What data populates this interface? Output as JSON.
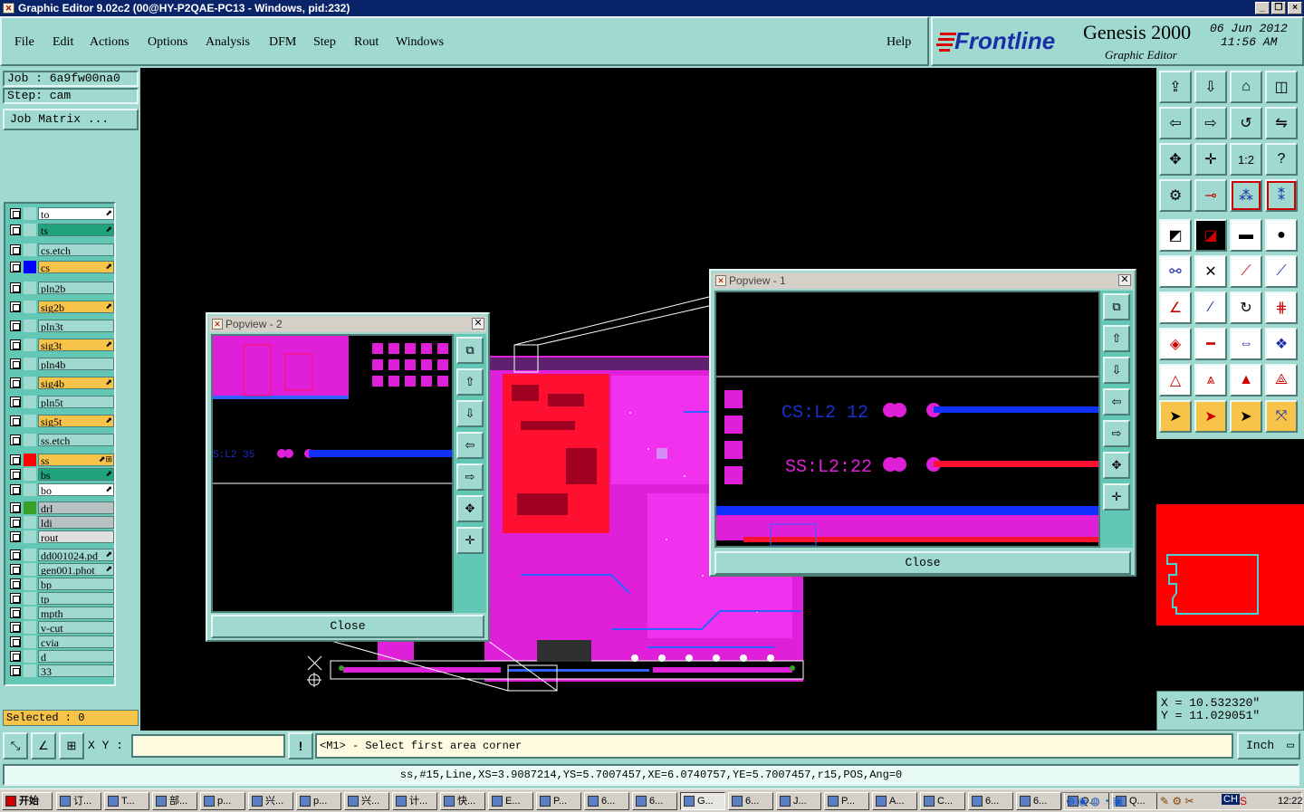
{
  "window": {
    "title": "Graphic Editor 9.02c2 (00@HY-P2QAE-PC13 - Windows, pid:232)",
    "controls": [
      "_",
      "❐",
      "×"
    ]
  },
  "menu": [
    "File",
    "Edit",
    "Actions",
    "Options",
    "Analysis",
    "DFM",
    "Step",
    "Rout",
    "Windows"
  ],
  "help_label": "Help",
  "brand": {
    "logo": "Frontline",
    "product": "Genesis 2000",
    "subtitle": "Graphic Editor",
    "date": "06 Jun 2012",
    "time": "11:56 AM"
  },
  "job": {
    "job_label": "Job : 6a9fw00na0",
    "step_label": "Step: cam",
    "matrix_button": "Job Matrix ..."
  },
  "layers": [
    {
      "name": "to",
      "color": "#ffffff",
      "swatch": "#9fd9cf",
      "edit": "⬈"
    },
    {
      "name": "ts",
      "color": "#1fa37c",
      "swatch": "#9fd9cf",
      "edit": "⬈"
    },
    {
      "name": "cs.etch",
      "color": "#9fd9cf",
      "swatch": "#9fd9cf",
      "edit": ""
    },
    {
      "name": "cs",
      "color": "#f7c349",
      "swatch": "#0000ff",
      "edit": "⬈"
    },
    {
      "name": "pln2b",
      "color": "#9fd9cf",
      "swatch": "#9fd9cf",
      "edit": ""
    },
    {
      "name": "sig2b",
      "color": "#f7c349",
      "swatch": "#9fd9cf",
      "edit": "⬈"
    },
    {
      "name": "pln3t",
      "color": "#9fd9cf",
      "swatch": "#9fd9cf",
      "edit": ""
    },
    {
      "name": "sig3t",
      "color": "#f7c349",
      "swatch": "#9fd9cf",
      "edit": "⬈"
    },
    {
      "name": "pln4b",
      "color": "#9fd9cf",
      "swatch": "#9fd9cf",
      "edit": ""
    },
    {
      "name": "sig4b",
      "color": "#f7c349",
      "swatch": "#9fd9cf",
      "edit": "⬈"
    },
    {
      "name": "pln5t",
      "color": "#9fd9cf",
      "swatch": "#9fd9cf",
      "edit": ""
    },
    {
      "name": "sig5t",
      "color": "#f7c349",
      "swatch": "#9fd9cf",
      "edit": "⬈"
    },
    {
      "name": "ss.etch",
      "color": "#9fd9cf",
      "swatch": "#9fd9cf",
      "edit": ""
    },
    {
      "name": "ss",
      "color": "#f7c349",
      "swatch": "#ff0000",
      "edit": "⬈⊞"
    },
    {
      "name": "bs",
      "color": "#1fa37c",
      "swatch": "#9fd9cf",
      "edit": "⬈"
    },
    {
      "name": "bo",
      "color": "#ffffff",
      "swatch": "#9fd9cf",
      "edit": "⬈"
    },
    {
      "name": "drl",
      "color": "#b9c2c2",
      "swatch": "#3aa02a",
      "edit": ""
    },
    {
      "name": "ldi",
      "color": "#b9c2c2",
      "swatch": "#9fd9cf",
      "edit": ""
    },
    {
      "name": "rout",
      "color": "#e0e0e0",
      "swatch": "#9fd9cf",
      "edit": ""
    },
    {
      "name": "dd001024.pd",
      "color": "#9fd9cf",
      "swatch": "#9fd9cf",
      "edit": "⬈"
    },
    {
      "name": "gen001.phot",
      "color": "#9fd9cf",
      "swatch": "#9fd9cf",
      "edit": "⬈"
    },
    {
      "name": "bp",
      "color": "#9fd9cf",
      "swatch": "#9fd9cf",
      "edit": ""
    },
    {
      "name": "tp",
      "color": "#9fd9cf",
      "swatch": "#9fd9cf",
      "edit": ""
    },
    {
      "name": "mpth",
      "color": "#9fd9cf",
      "swatch": "#9fd9cf",
      "edit": ""
    },
    {
      "name": "v-cut",
      "color": "#9fd9cf",
      "swatch": "#9fd9cf",
      "edit": ""
    },
    {
      "name": "cvia",
      "color": "#9fd9cf",
      "swatch": "#9fd9cf",
      "edit": ""
    },
    {
      "name": "d",
      "color": "#9fd9cf",
      "swatch": "#9fd9cf",
      "edit": ""
    },
    {
      "name": "33",
      "color": "#9fd9cf",
      "swatch": "#9fd9cf",
      "edit": ""
    }
  ],
  "selected_label": "Selected : 0",
  "popview2": {
    "title": "Popview - 2",
    "close": "Close",
    "label": "S:L2 35"
  },
  "popview1": {
    "title": "Popview - 1",
    "close": "Close",
    "label_cs": "CS:L2 12",
    "label_ss": "SS:L2:22"
  },
  "toolbar": {
    "tool_1_2": "1:2",
    "tool_help": "?"
  },
  "coords": {
    "x": "X  =  10.532320\"",
    "y": "Y  =  11.029051\""
  },
  "cmd": {
    "xy_label": "X Y :",
    "xy_value": "",
    "prompt": "<M1> - Select first area corner",
    "unit": "Inch"
  },
  "status": "ss,#15,Line,XS=3.9087214,YS=5.7007457,XE=6.0740757,YE=5.7007457,r15,POS,Ang=0",
  "taskbar": {
    "start": "开始",
    "tasks": [
      "订...",
      "T...",
      "部...",
      "p...",
      "兴...",
      "p...",
      "兴...",
      "计...",
      "快...",
      "E...",
      "P...",
      "6...",
      "6...",
      "G...",
      "6...",
      "J...",
      "P...",
      "A...",
      "C...",
      "6...",
      "6...",
      "Q...",
      "Q..."
    ],
    "clock": "12:22",
    "lang": "CH"
  }
}
